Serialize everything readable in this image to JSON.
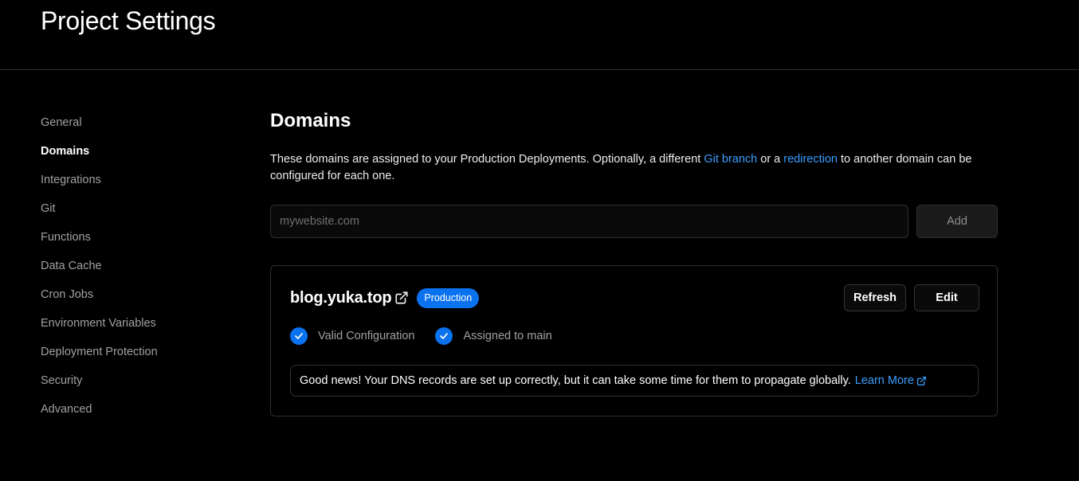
{
  "header": {
    "title": "Project Settings"
  },
  "sidebar": {
    "items": [
      {
        "label": "General"
      },
      {
        "label": "Domains"
      },
      {
        "label": "Integrations"
      },
      {
        "label": "Git"
      },
      {
        "label": "Functions"
      },
      {
        "label": "Data Cache"
      },
      {
        "label": "Cron Jobs"
      },
      {
        "label": "Environment Variables"
      },
      {
        "label": "Deployment Protection"
      },
      {
        "label": "Security"
      },
      {
        "label": "Advanced"
      }
    ],
    "active": "Domains"
  },
  "main": {
    "title": "Domains",
    "description": {
      "part1": "These domains are assigned to your Production Deployments. Optionally, a different ",
      "link1": "Git branch",
      "part2": " or a ",
      "link2": "redirection",
      "part3": " to another domain can be configured for each one."
    },
    "input": {
      "placeholder": "mywebsite.com",
      "value": ""
    },
    "add_label": "Add",
    "domain": {
      "name": "blog.yuka.top",
      "badge": "Production",
      "refresh_label": "Refresh",
      "edit_label": "Edit",
      "statuses": [
        {
          "label": "Valid Configuration"
        },
        {
          "label": "Assigned to main"
        }
      ],
      "notice": {
        "text": "Good news! Your DNS records are set up correctly, but it can take some time for them to propagate globally.",
        "link": "Learn More"
      }
    }
  },
  "colors": {
    "accent": "#0a72ef",
    "link": "#3b9eff",
    "background": "#000000",
    "border": "#2e2e2e"
  },
  "icons": {
    "external_link": "external-link-icon",
    "check": "check-circle-icon"
  }
}
